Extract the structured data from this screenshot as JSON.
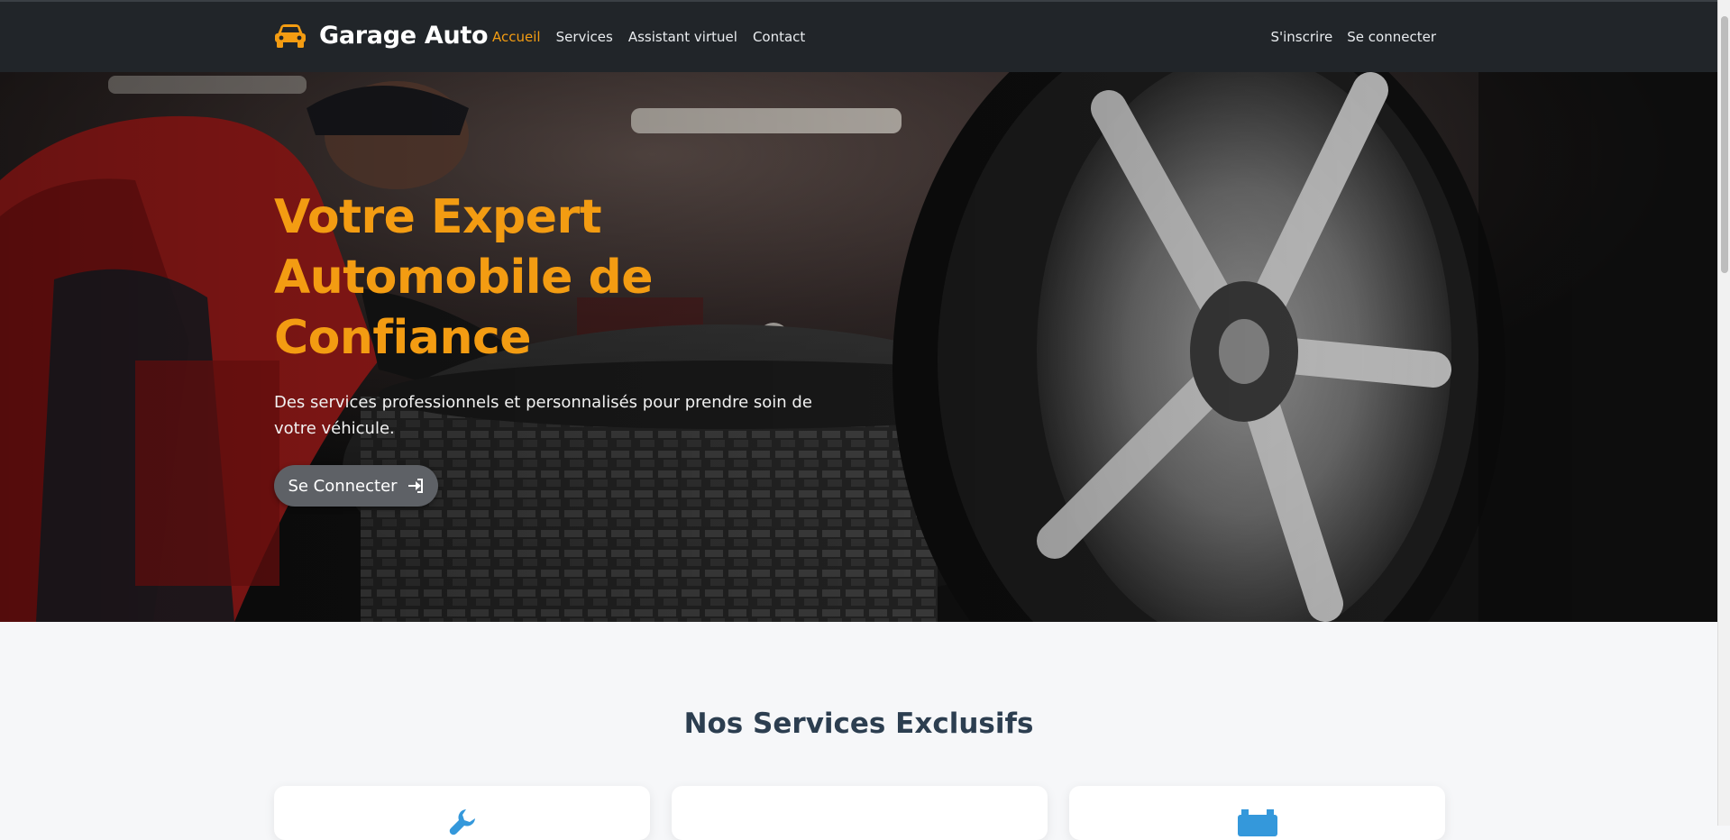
{
  "brand": {
    "name": "Garage Auto",
    "icon": "car-icon"
  },
  "nav": {
    "items": [
      {
        "label": "Accueil",
        "active": true
      },
      {
        "label": "Services",
        "active": false
      },
      {
        "label": "Assistant virtuel",
        "active": false
      },
      {
        "label": "Contact",
        "active": false
      }
    ],
    "right": [
      {
        "label": "S'inscrire"
      },
      {
        "label": "Se connecter"
      }
    ]
  },
  "hero": {
    "title": "Votre Expert Automobile de Confiance",
    "subtitle": "Des services professionnels et personnalisés pour prendre soin de votre véhicule.",
    "cta_label": "Se Connecter",
    "cta_icon": "login-icon"
  },
  "services": {
    "title": "Nos Services Exclusifs",
    "cards": [
      {
        "icon": "wrench-icon"
      },
      {
        "icon": ""
      },
      {
        "icon": "car-battery-icon"
      }
    ]
  },
  "colors": {
    "accent": "#f39c12",
    "navbar": "#212529",
    "heading": "#2c3e50",
    "page_bg": "#f6f7f9",
    "icon_blue": "#3498db"
  }
}
